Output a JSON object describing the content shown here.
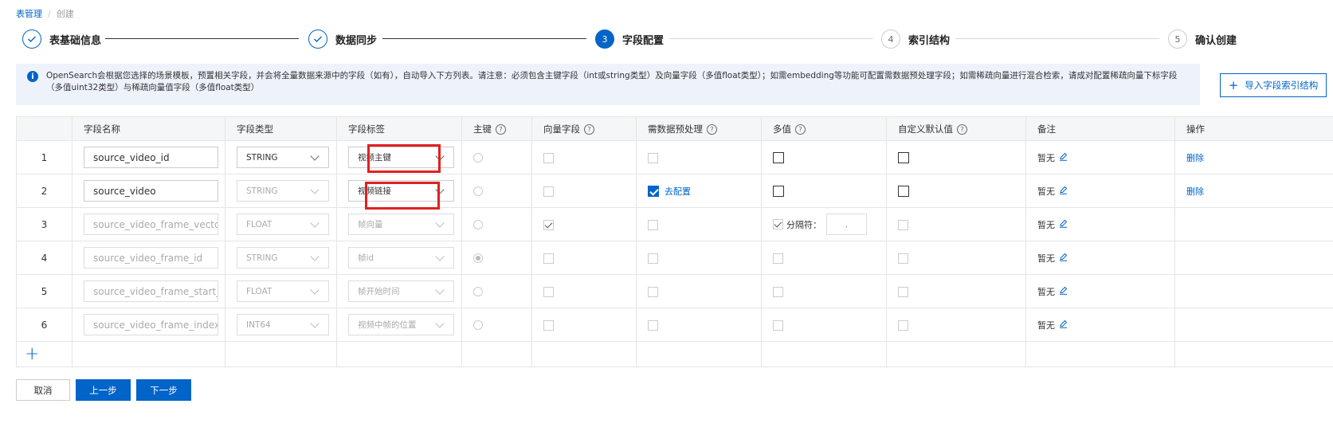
{
  "breadcrumb": {
    "root": "表管理",
    "separator": "/",
    "current": "创建"
  },
  "steps": [
    {
      "index": "1",
      "label": "表基础信息",
      "state": "done"
    },
    {
      "index": "2",
      "label": "数据同步",
      "state": "done"
    },
    {
      "index": "3",
      "label": "字段配置",
      "state": "active"
    },
    {
      "index": "4",
      "label": "索引结构",
      "state": "todo"
    },
    {
      "index": "5",
      "label": "确认创建",
      "state": "todo"
    }
  ],
  "info": {
    "text": "OpenSearch会根据您选择的场景模板，预置相关字段，并会将全量数据来源中的字段（如有），自动导入下方列表。请注意：必须包含主键字段（int或string类型）及向量字段（多值float类型）；如需embedding等功能可配置需数据预处理字段；如需稀疏向量进行混合检索，请成对配置稀疏向量下标字段（多值uint32类型）与稀疏向量值字段（多值float类型）"
  },
  "import_button": {
    "label": "导入字段索引结构"
  },
  "table": {
    "headers": {
      "name": "字段名称",
      "type": "字段类型",
      "tag": "字段标签",
      "primary": "主键",
      "vector": "向量字段",
      "preprocess": "需数据预处理",
      "multi": "多值",
      "default": "自定义默认值",
      "remark": "备注",
      "action": "操作"
    },
    "rows": [
      {
        "index": "1",
        "name": "source_video_id",
        "type": "STRING",
        "tag": "视频主键",
        "remark": "暂无",
        "action": "删除"
      },
      {
        "index": "2",
        "name": "source_video",
        "type": "STRING",
        "tag": "视频链接",
        "preprocess_link": "去配置",
        "remark": "暂无",
        "action": "删除"
      },
      {
        "index": "3",
        "name": "source_video_frame_vector",
        "type": "FLOAT",
        "tag": "帧向量",
        "separator_label": "分隔符：",
        "separator_value": ",",
        "remark": "暂无"
      },
      {
        "index": "4",
        "name": "source_video_frame_id",
        "type": "STRING",
        "tag": "帧id",
        "remark": "暂无"
      },
      {
        "index": "5",
        "name": "source_video_frame_start_time",
        "type": "FLOAT",
        "tag": "帧开始时间",
        "remark": "暂无"
      },
      {
        "index": "6",
        "name": "source_video_frame_index",
        "type": "INT64",
        "tag": "视频中帧的位置",
        "remark": "暂无"
      }
    ],
    "add_symbol": "+"
  },
  "buttons": {
    "cancel": "取消",
    "prev": "上一步",
    "next": "下一步"
  },
  "colors": {
    "primary": "#0064c8",
    "highlight": "#e02020",
    "info_bg": "#eef3fb"
  }
}
